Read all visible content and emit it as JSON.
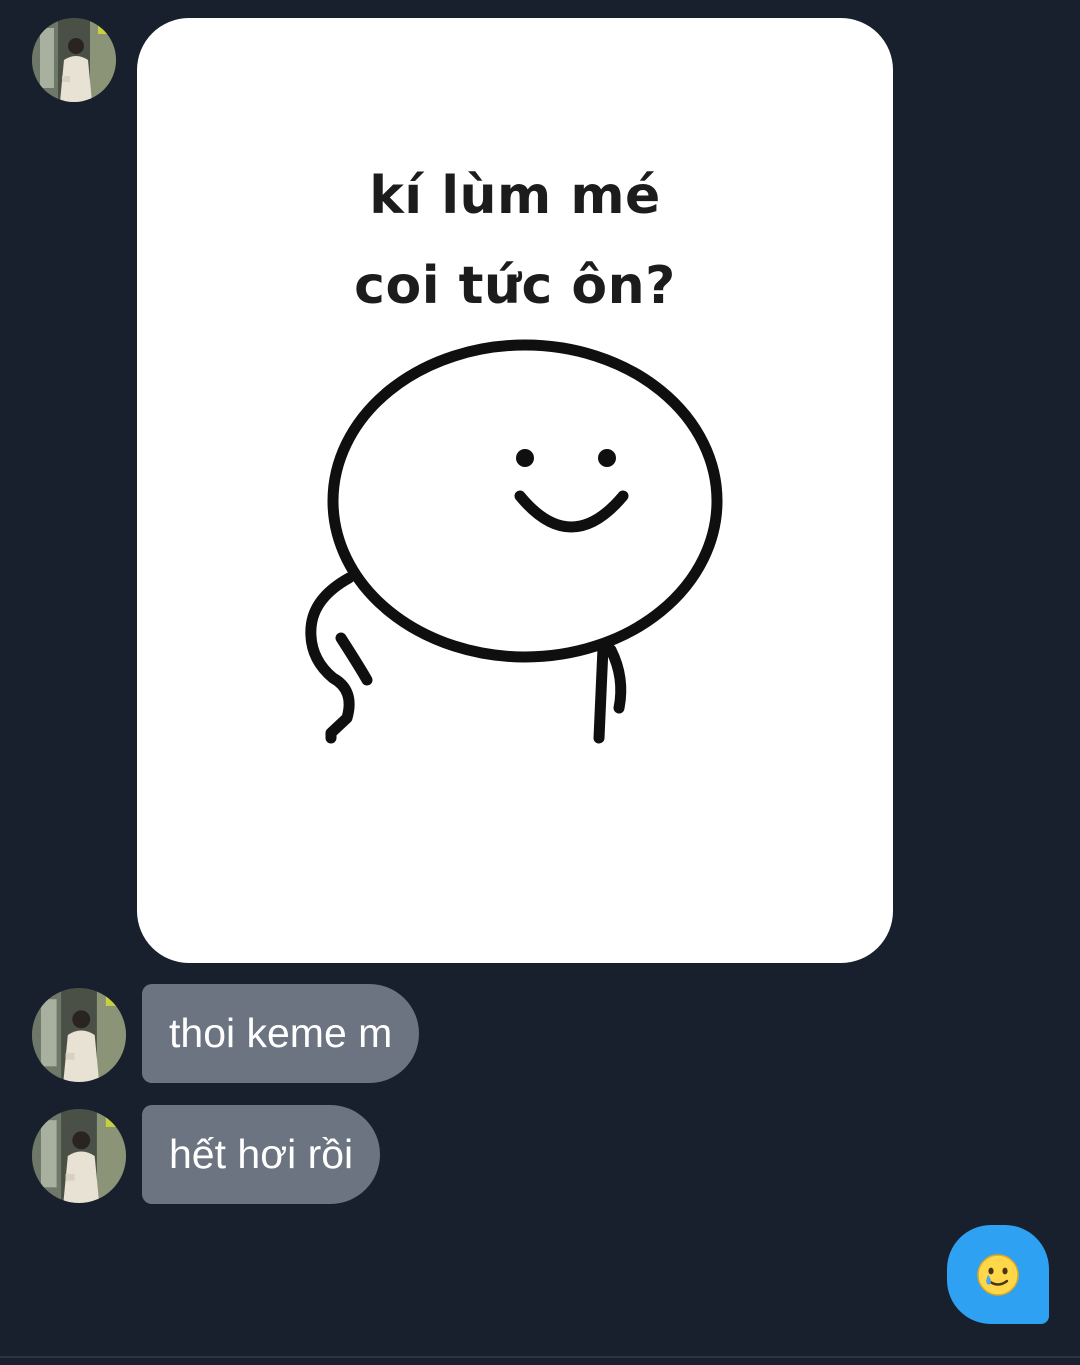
{
  "conversation": {
    "sticker": {
      "caption_line1": "kí lùm mé",
      "caption_line2": "coi tức ôn?",
      "figure": "smiling-round-head-hand-on-hip"
    },
    "messages": [
      {
        "text": "thoi keme m",
        "from": "contact"
      },
      {
        "text": "hết hơi rồi",
        "from": "contact"
      }
    ],
    "my_reply": {
      "type": "emoji",
      "icon": "smiling-face-with-tear-icon"
    }
  },
  "colors": {
    "background": "#17202c",
    "incoming_bubble": "#6b7480",
    "outgoing_bubble": "#2ea1f2",
    "sticker_card": "#ffffff"
  }
}
